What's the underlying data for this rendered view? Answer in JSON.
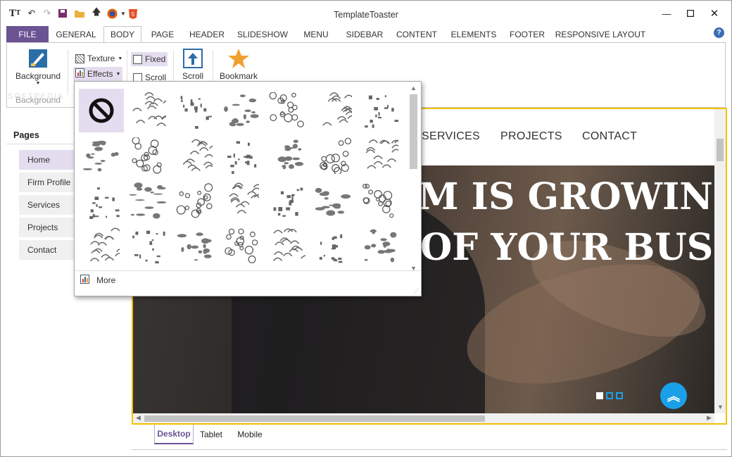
{
  "window": {
    "title": "TemplateToaster"
  },
  "quick_access": [
    "tt-logo-icon",
    "undo-icon",
    "redo-icon",
    "save-icon",
    "open-folder-icon",
    "upload-icon",
    "firefox-icon",
    "html5-icon"
  ],
  "tabs": {
    "file": "FILE",
    "items": [
      "GENERAL",
      "BODY",
      "PAGE",
      "HEADER",
      "SLIDESHOW",
      "MENU",
      "SIDEBAR",
      "CONTENT",
      "ELEMENTS",
      "FOOTER",
      "RESPONSIVE LAYOUT"
    ],
    "active": "BODY",
    "help": "?"
  },
  "ribbon": {
    "background_label": "Background",
    "group_label": "Background",
    "texture_label": "Texture",
    "effects_label": "Effects",
    "fixed_label": "Fixed",
    "scroll_label": "Scroll",
    "scroll_big_label": "Scroll",
    "bookmark_label": "Bookmark"
  },
  "pages_panel": {
    "title": "Pages",
    "items": [
      "Home",
      "Firm Profile",
      "Services",
      "Projects",
      "Contact"
    ],
    "selected": "Home"
  },
  "site_preview": {
    "nav_links": [
      "SERVICES",
      "PROJECTS",
      "CONTACT"
    ],
    "headline_line1": "M IS GROWING A",
    "headline_line2": "OF YOUR BUSIN",
    "slide_dots": 3,
    "active_dot": 0
  },
  "view_tabs": {
    "items": [
      "Desktop",
      "Tablet",
      "Mobile"
    ],
    "active": "Desktop"
  },
  "effects_dropdown": {
    "more_label": "More",
    "tile_count": 28,
    "selected_tile": "none"
  },
  "watermark": "SOFTPEDIA",
  "colors": {
    "accent": "#6b5394",
    "highlight": "#e4dcef",
    "canvas_border": "#f2c200",
    "scroll_top": "#1aa0e8"
  }
}
